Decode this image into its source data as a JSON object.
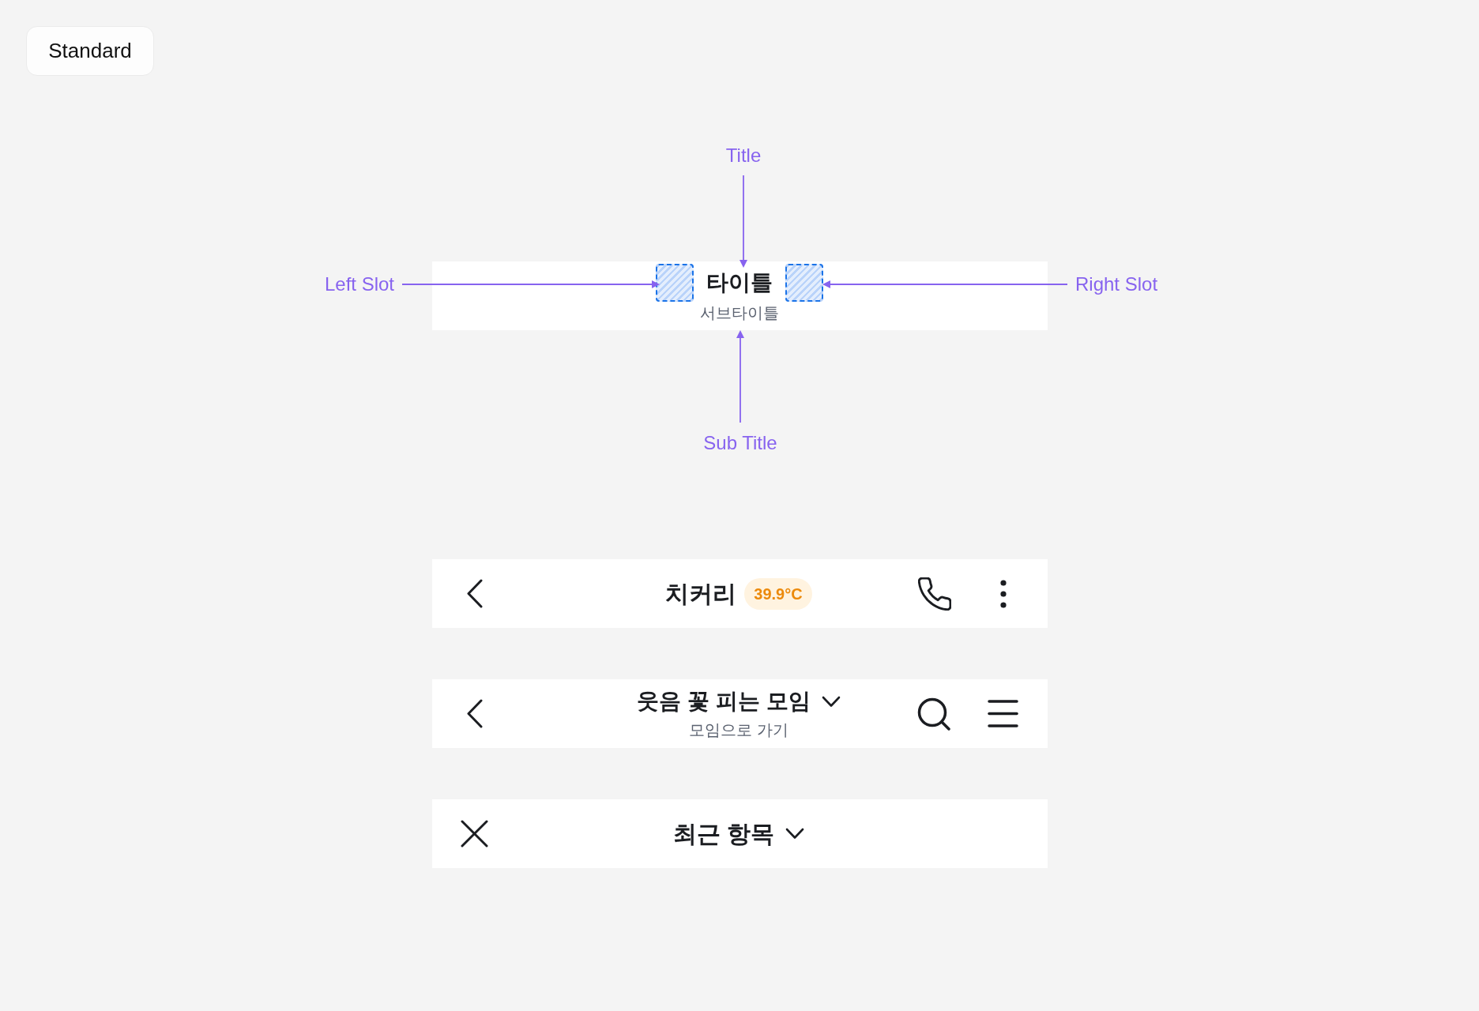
{
  "variant_label": "Standard",
  "anatomy": {
    "title": "타이틀",
    "subtitle": "서브타이틀",
    "callouts": [
      {
        "kind": "title",
        "label": "Title"
      },
      {
        "kind": "left_slot",
        "label": "Left Slot"
      },
      {
        "kind": "right_slot",
        "label": "Right Slot"
      },
      {
        "kind": "subtitle",
        "label": "Sub Title"
      }
    ]
  },
  "examples": [
    {
      "title": "치커리",
      "badge": "39.9°C",
      "dropdown": false
    },
    {
      "title": "웃음 꽃 피는 모임",
      "subtitle": "모임으로 가기",
      "dropdown": true
    },
    {
      "title": "최근 항목",
      "dropdown": true
    }
  ]
}
